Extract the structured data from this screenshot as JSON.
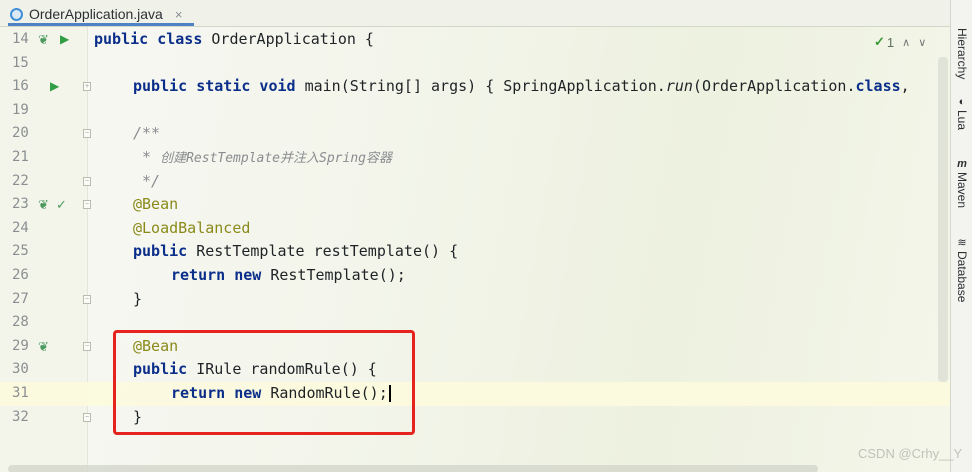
{
  "tab": {
    "label": "OrderApplication.java",
    "close": "×"
  },
  "inspections": {
    "count": "1",
    "check": "✓"
  },
  "tool_windows": [
    {
      "label": "Hierarchy",
      "icon": "hierarchy-icon"
    },
    {
      "label": "Lua",
      "icon": "lua-icon",
      "glyph": "◐"
    },
    {
      "label": "Maven",
      "icon": "maven-icon",
      "glyph": "m"
    },
    {
      "label": "Database",
      "icon": "database-icon",
      "glyph": "≋"
    }
  ],
  "lines": [
    {
      "no": "14"
    },
    {
      "no": "15"
    },
    {
      "no": "16"
    },
    {
      "no": "19"
    },
    {
      "no": "20"
    },
    {
      "no": "21"
    },
    {
      "no": "22"
    },
    {
      "no": "23"
    },
    {
      "no": "24"
    },
    {
      "no": "25"
    },
    {
      "no": "26"
    },
    {
      "no": "27"
    },
    {
      "no": "28"
    },
    {
      "no": "29"
    },
    {
      "no": "30"
    },
    {
      "no": "31"
    },
    {
      "no": "32"
    }
  ],
  "code": {
    "l14_kw": "public class",
    "l14_rest": " OrderApplication {",
    "l16_kw": "public static void",
    "l16_rest1": " main(String[] args) { SpringApplication.",
    "l16_call": "run",
    "l16_rest2": "(OrderApplication.",
    "l16_kw2": "class",
    "l16_rest3": ",",
    "l20": "/**",
    "l21_star": " * ",
    "l21_text": "创建RestTemplate并注入Spring容器",
    "l22": " */",
    "l23": "@Bean",
    "l24": "@LoadBalanced",
    "l25_kw": "public",
    "l25_rest": " RestTemplate restTemplate() {",
    "l26_kw": "return new",
    "l26_rest": " RestTemplate();",
    "l27": "}",
    "l29": "@Bean",
    "l30_kw": "public",
    "l30_rest": " IRule randomRule() {",
    "l31_kw": "return new",
    "l31_rest": " RandomRule();",
    "l32": "}"
  },
  "watermark": "CSDN @Crhy__Y",
  "colors": {
    "keyword": "#0b2e8a",
    "annotation": "#8a8a1a",
    "comment": "#8a8c90",
    "highlight": "#e5231f"
  }
}
